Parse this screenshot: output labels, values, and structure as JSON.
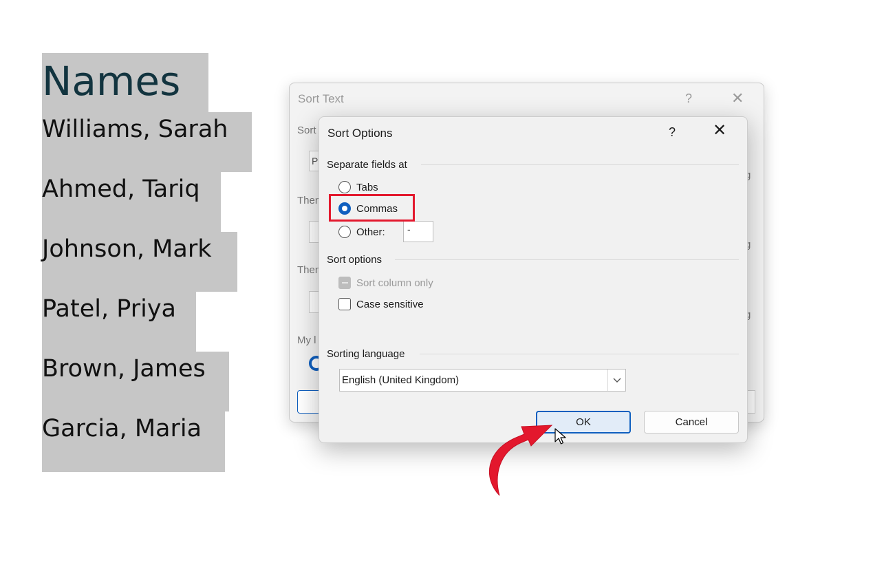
{
  "document": {
    "title": "Names",
    "lines": [
      "Williams, Sarah",
      "Ahmed, Tariq",
      "Johnson, Mark",
      "Patel, Priya",
      "Brown, James",
      "Garcia, Maria"
    ]
  },
  "back_dialog": {
    "title": "Sort Text",
    "help": "?",
    "close": "✕",
    "sort_label": "Sort",
    "sort_box": "Pa",
    "then1_label": "Then",
    "then2_label": "Then",
    "my_label": "My l",
    "g": "g"
  },
  "dialog": {
    "title": "Sort Options",
    "help": "?",
    "close": "✕",
    "separate_label": "Separate fields at",
    "tabs_label": "Tabs",
    "commas_label": "Commas",
    "other_label": "Other:",
    "other_value": "-",
    "sort_options_label": "Sort options",
    "sort_column_only_label": "Sort column only",
    "case_sensitive_label": "Case sensitive",
    "sorting_language_label": "Sorting language",
    "language_value": "English (United Kingdom)",
    "ok_label": "OK",
    "cancel_label": "Cancel"
  },
  "colors": {
    "accent": "#0f5fbf",
    "highlight": "#e3182d",
    "selection": "#c6c6c6"
  }
}
